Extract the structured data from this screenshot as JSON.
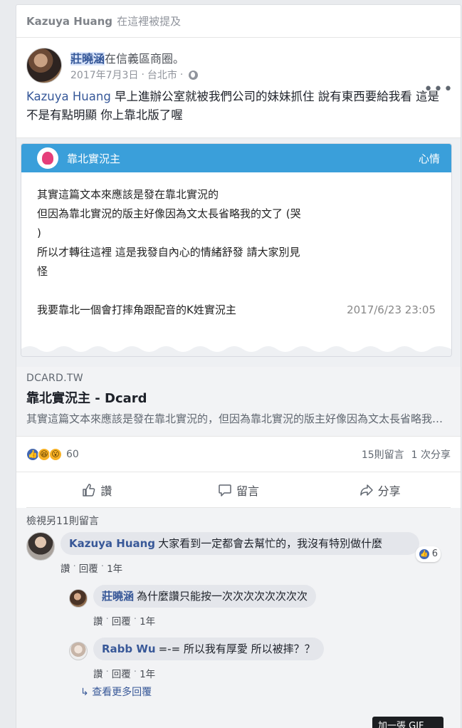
{
  "mention": {
    "name": "Kazuya Huang",
    "text": "在這裡被提及"
  },
  "post": {
    "author": "莊曉涵",
    "location_text": "在信義區商圈。",
    "date": "2017年7月3日",
    "separator": "·",
    "city": "台北市",
    "privacy_icon": "globe-icon",
    "more_icon": "•••",
    "tagged": "Kazuya Huang",
    "body": " 早上進辦公室就被我們公司的妹妹抓住 說有東西要給我看 這是不是有點明顯 你上靠北版了喔"
  },
  "preview": {
    "board": "靠北實況主",
    "mood": "心情",
    "lines": [
      "其實這篇文本來應該是發在靠北實況的",
      "但因為靠北實況的版主好像因為文太長省略我的文了 (哭",
      ")",
      "所以才轉往這裡 這是我發自內心的情緒舒發 請大家別見",
      "怪"
    ],
    "last_line": "我要靠北一個會打摔角跟配音的K姓實況主",
    "timestamp": "2017/6/23 23:05"
  },
  "link": {
    "domain": "DCARD.TW",
    "title": "靠北實況主 - Dcard",
    "description": "其實這篇文本來應該是發在靠北實況的，但因為靠北實況的版主好像因為文太長省略我的文了"
  },
  "reactions": {
    "count": "60",
    "comments": "15則留言",
    "shares": "1 次分享",
    "icons": [
      "like-icon",
      "haha-icon",
      "wow-icon"
    ]
  },
  "actions": {
    "like": "讚",
    "comment": "留言",
    "share": "分享"
  },
  "comments": {
    "view_more": "檢視另11則留言",
    "items": [
      {
        "name": "Kazuya Huang",
        "text": "大家看到一定都會去幫忙的，我沒有特別做什麼",
        "like": "讚",
        "reply": "回覆",
        "time": "1年",
        "likes": "6"
      }
    ],
    "replies": [
      {
        "name": "莊曉涵",
        "text": "為什麼讚只能按一次次次次次次次次",
        "like": "讚",
        "reply": "回覆",
        "time": "1年"
      },
      {
        "name": "Rabb Wu",
        "text": "=-= 所以我有厚愛 所以被摔？？",
        "like": "讚",
        "reply": "回覆",
        "time": "1年"
      }
    ],
    "more_replies": "查看更多回覆"
  },
  "overlay": {
    "gif": "加一張 GIF"
  }
}
